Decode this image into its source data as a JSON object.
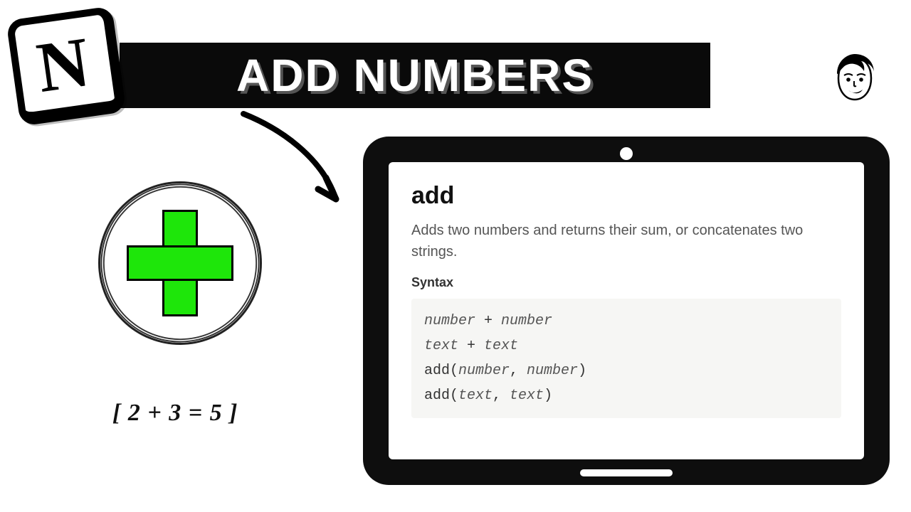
{
  "header": {
    "title": "ADD NUMBERS",
    "logo_letter": "N"
  },
  "left": {
    "equation": "[ 2 + 3 = 5 ]"
  },
  "doc": {
    "title": "add",
    "description": "Adds two numbers and returns their sum, or concatenates two strings.",
    "syntax_label": "Syntax",
    "syntax_lines": [
      {
        "plain_before": "",
        "italic": "number",
        "plain_mid": " + ",
        "italic2": "number",
        "plain_after": ""
      },
      {
        "plain_before": "",
        "italic": "text",
        "plain_mid": " + ",
        "italic2": "text",
        "plain_after": ""
      },
      {
        "plain_before": "add(",
        "italic": "number",
        "plain_mid": ", ",
        "italic2": "number",
        "plain_after": ")"
      },
      {
        "plain_before": "add(",
        "italic": "text",
        "plain_mid": ", ",
        "italic2": "text",
        "plain_after": ")"
      }
    ]
  }
}
